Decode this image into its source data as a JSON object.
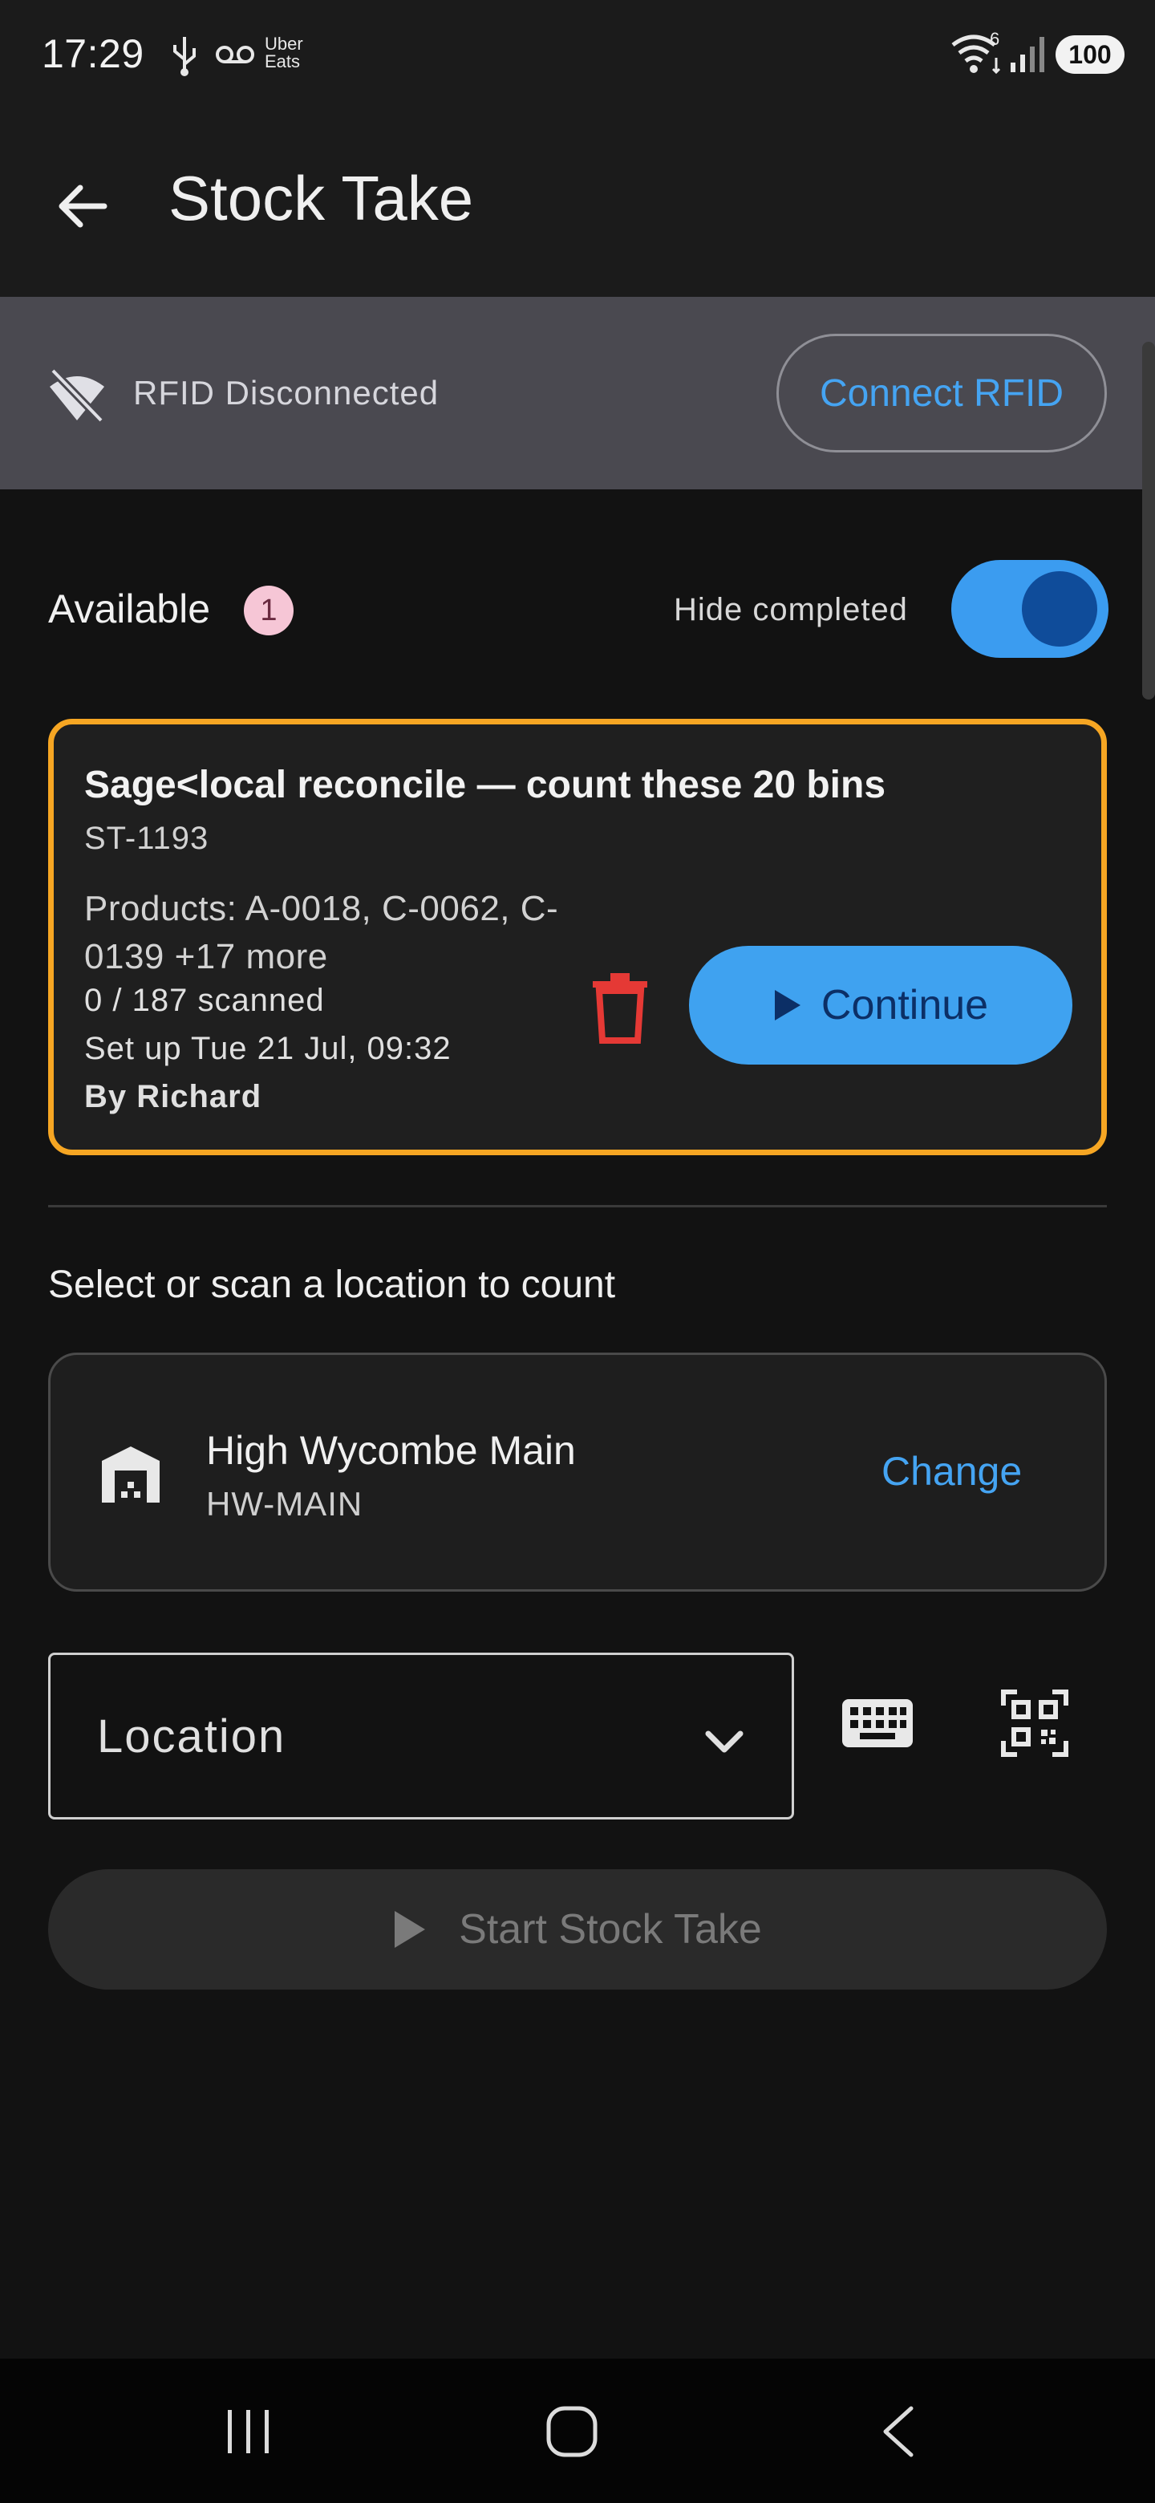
{
  "status_bar": {
    "time": "17:29",
    "uber_line1": "Uber",
    "uber_line2": "Eats",
    "wifi_badge": "6",
    "battery": "100"
  },
  "app_bar": {
    "title": "Stock Take",
    "back_icon": "arrow-back-icon"
  },
  "rfid": {
    "status_text": "RFID Disconnected",
    "connect_label": "Connect RFID",
    "icon": "wifi-off-icon"
  },
  "available": {
    "label": "Available",
    "count": "1",
    "hide_completed_label": "Hide completed",
    "hide_completed_on": true
  },
  "session": {
    "title": "Sage<local reconcile — count these 20 bins",
    "code": "ST-1193",
    "products": "Products: A-0018, C-0062, C-0139 +17 more",
    "scanned": "0 / 187 scanned",
    "setup": "Set up Tue 21 Jul, 09:32",
    "by": "By Richard",
    "continue_label": "Continue",
    "accent": "#f6a623"
  },
  "location_section": {
    "prompt": "Select or scan a location to count",
    "site_name": "High Wycombe Main",
    "site_code": "HW-MAIN",
    "change_label": "Change",
    "dropdown_label": "Location"
  },
  "start_label": "Start Stock Take",
  "colors": {
    "primary": "#3fa2f0",
    "link": "#45a4f2",
    "danger": "#e53935",
    "background": "#121212"
  }
}
